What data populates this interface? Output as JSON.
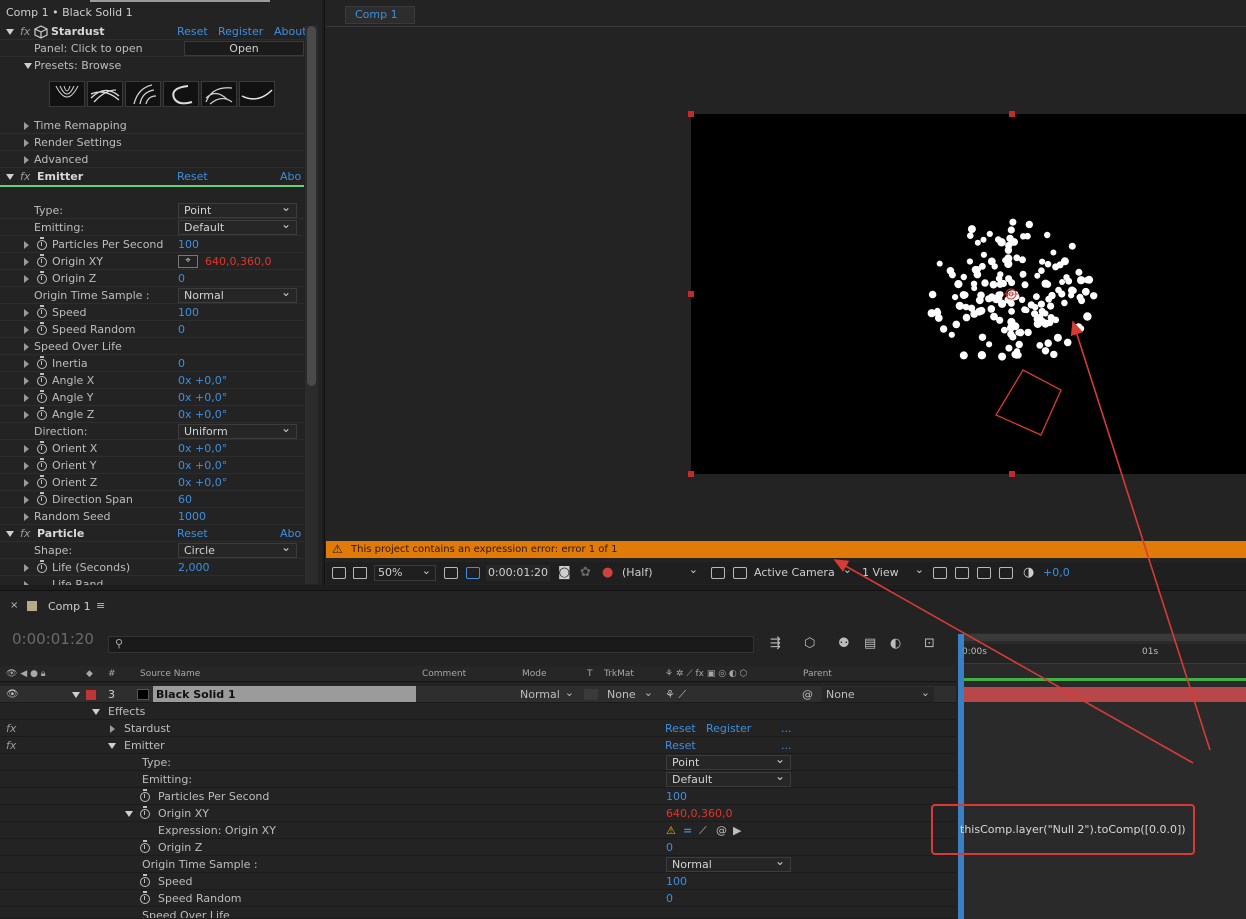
{
  "effect_controls": {
    "header": "Comp 1 • Black Solid 1",
    "stardust": {
      "name": "Stardust",
      "reset": "Reset",
      "register": "Register",
      "about": "About",
      "panel_label": "Panel: Click to open",
      "open_button": "Open",
      "presets_label": "Presets: Browse",
      "groups": [
        "Time Remapping",
        "Render Settings",
        "Advanced"
      ]
    },
    "emitter": {
      "name": "Emitter",
      "reset": "Reset",
      "about": "Abo",
      "type_label": "Type:",
      "type_value": "Point",
      "emitting_label": "Emitting:",
      "emitting_value": "Default",
      "pps_label": "Particles Per Second",
      "pps_value": "100",
      "origin_xy_label": "Origin XY",
      "origin_x": "640,0",
      "origin_sep": ",",
      "origin_y": "360,0",
      "origin_z_label": "Origin Z",
      "origin_z_value": "0",
      "ots_label": "Origin Time Sample :",
      "ots_value": "Normal",
      "speed_label": "Speed",
      "speed_value": "100",
      "speed_random_label": "Speed Random",
      "speed_random_value": "0",
      "speed_over_life_label": "Speed Over Life",
      "inertia_label": "Inertia",
      "inertia_value": "0",
      "angle_x_label": "Angle X",
      "angle_x_value": "0x +0,0°",
      "angle_y_label": "Angle Y",
      "angle_y_value": "0x +0,0°",
      "angle_z_label": "Angle Z",
      "angle_z_value": "0x +0,0°",
      "direction_label": "Direction:",
      "direction_value": "Uniform",
      "orient_x_label": "Orient X",
      "orient_x_value": "0x +0,0°",
      "orient_y_label": "Orient Y",
      "orient_y_value": "0x +0,0°",
      "orient_z_label": "Orient Z",
      "orient_z_value": "0x +0,0°",
      "direction_span_label": "Direction Span",
      "direction_span_value": "60",
      "random_seed_label": "Random Seed",
      "random_seed_value": "1000"
    },
    "particle": {
      "name": "Particle",
      "reset": "Reset",
      "about": "Abo",
      "shape_label": "Shape:",
      "shape_value": "Circle",
      "life_label": "Life (Seconds)",
      "life_value": "2,000",
      "life_random_label": "Life Rand..."
    }
  },
  "viewer": {
    "tab": "Comp 1",
    "error_message": "This project contains an expression error: error 1 of 1",
    "zoom": "50%",
    "timecode": "0:00:01:20",
    "resolution": "(Half)",
    "camera": "Active Camera",
    "views": "1 View",
    "exposure": "+0,0"
  },
  "timeline": {
    "tab": "Comp 1",
    "timecode": "0:00:01:20",
    "search_placeholder": "",
    "columns": {
      "num": "#",
      "source_name": "Source Name",
      "comment": "Comment",
      "mode": "Mode",
      "t": "T",
      "trkmat": "TrkMat",
      "parent": "Parent"
    },
    "ruler": {
      "start": "0:00s",
      "mark": "01s"
    },
    "layer": {
      "number": "3",
      "name": "Black Solid 1",
      "mode": "Normal",
      "trkmat": "None",
      "parent": "None",
      "label_color": "#c23535"
    },
    "effects_label": "Effects",
    "stardust_label": "Stardust",
    "stardust_reset": "Reset",
    "stardust_register": "Register",
    "dots": "...",
    "emitter_label": "Emitter",
    "emitter_reset": "Reset",
    "props": {
      "type_label": "Type:",
      "type_value": "Point",
      "emitting_label": "Emitting:",
      "emitting_value": "Default",
      "pps_label": "Particles Per Second",
      "pps_value": "100",
      "origin_xy_label": "Origin XY",
      "origin_x": "640,0",
      "origin_sep": ",",
      "origin_y": "360,0",
      "expr_label": "Expression: Origin XY",
      "origin_z_label": "Origin Z",
      "origin_z_value": "0",
      "ots_label": "Origin Time Sample :",
      "ots_value": "Normal",
      "speed_label": "Speed",
      "speed_value": "100",
      "speed_random_label": "Speed Random",
      "speed_random_value": "0",
      "speed_over_life_label": "Speed Over Life"
    },
    "expression": "thisComp.layer(\"Null 2\").toComp([0.0.0])"
  },
  "colors": {
    "accent_blue": "#3d8fe0",
    "value_red": "#e0352b",
    "error_bar": "#e07b0a",
    "annotation": "#d83a35"
  }
}
